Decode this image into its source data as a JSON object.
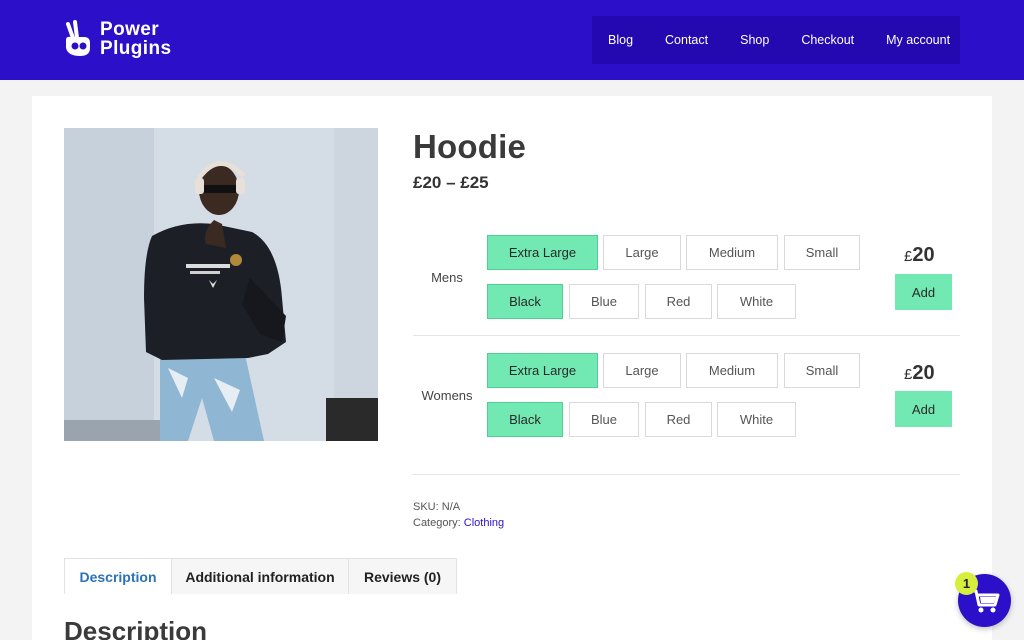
{
  "header": {
    "logo_line1": "Power",
    "logo_line2": "Plugins",
    "nav": [
      "Blog",
      "Contact",
      "Shop",
      "Checkout",
      "My account"
    ]
  },
  "product": {
    "title": "Hoodie",
    "price_range": "£20 – £25",
    "image_alt": "hoodie-photo",
    "variants": [
      {
        "label": "Mens",
        "sizes": [
          "Extra Large",
          "Large",
          "Medium",
          "Small"
        ],
        "selected_size": "Extra Large",
        "colors": [
          "Black",
          "Blue",
          "Red",
          "White"
        ],
        "selected_color": "Black",
        "currency": "£",
        "price": "20",
        "add_label": "Add"
      },
      {
        "label": "Womens",
        "sizes": [
          "Extra Large",
          "Large",
          "Medium",
          "Small"
        ],
        "selected_size": "Extra Large",
        "colors": [
          "Black",
          "Blue",
          "Red",
          "White"
        ],
        "selected_color": "Black",
        "currency": "£",
        "price": "20",
        "add_label": "Add"
      }
    ],
    "sku_label": "SKU:",
    "sku_value": "N/A",
    "category_label": "Category:",
    "category_value": "Clothing"
  },
  "tabs": [
    "Description",
    "Additional information",
    "Reviews (0)"
  ],
  "active_tab": "Description",
  "description_heading": "Description",
  "cart": {
    "count": "1",
    "icon": "cart-icon"
  },
  "colors": {
    "brand": "#2c0fc8",
    "accent": "#72e8b2",
    "badge": "#d6ef3c"
  }
}
